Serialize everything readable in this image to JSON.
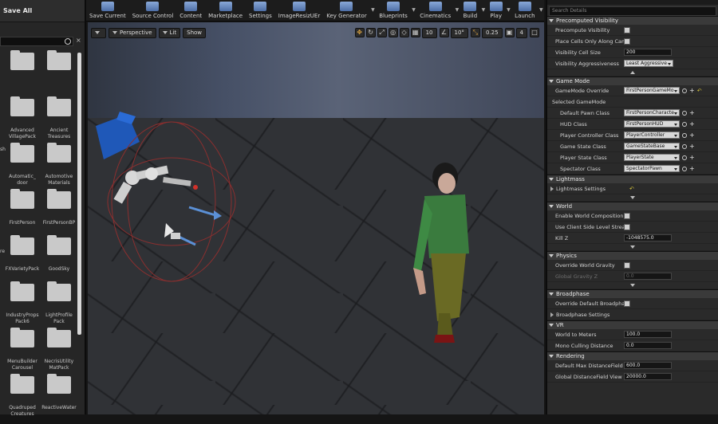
{
  "content_browser": {
    "save_all": "Save All",
    "folders": [
      {
        "label": "",
        "x": 0,
        "y": 0
      },
      {
        "label": "",
        "x": 1,
        "y": 0
      },
      {
        "label": "Advanced VillagePack",
        "x": 0,
        "y": 1
      },
      {
        "label": "Ancient Treasures",
        "x": 1,
        "y": 1
      },
      {
        "label": "Automatic_ door",
        "x": 0,
        "y": 2
      },
      {
        "label": "Automotive Materials",
        "x": 1,
        "y": 2
      },
      {
        "label": "FirstPerson",
        "x": 0,
        "y": 3
      },
      {
        "label": "FirstPersonBP",
        "x": 1,
        "y": 3
      },
      {
        "label": "FXVarietyPack",
        "x": 0,
        "y": 4
      },
      {
        "label": "GoodSky",
        "x": 1,
        "y": 4
      },
      {
        "label": "IndustryProps Pack6",
        "x": 0,
        "y": 5
      },
      {
        "label": "LightProfile Pack",
        "x": 1,
        "y": 5
      },
      {
        "label": "MenuBuilder Carousel",
        "x": 0,
        "y": 6
      },
      {
        "label": "NecrisUtility MatPack",
        "x": 1,
        "y": 6
      },
      {
        "label": "Quadruped Creatures",
        "x": 0,
        "y": 7
      },
      {
        "label": "ReactiveWater",
        "x": 1,
        "y": 7
      }
    ],
    "edge_labels": [
      "sh",
      "re"
    ]
  },
  "toolbar": {
    "buttons": [
      {
        "label": "Save Current",
        "icon": "save-icon"
      },
      {
        "label": "Source Control",
        "icon": "source-control-icon"
      },
      {
        "label": "Content",
        "icon": "content-icon"
      },
      {
        "label": "Marketplace",
        "icon": "marketplace-icon"
      },
      {
        "label": "Settings",
        "icon": "settings-icon"
      },
      {
        "label": "ImageResizUEr",
        "icon": "image-resize-icon"
      },
      {
        "label": "Key Generator",
        "icon": "key-generator-icon"
      },
      {
        "label": "Blueprints",
        "icon": "blueprints-icon"
      },
      {
        "label": "Cinematics",
        "icon": "cinematics-icon"
      },
      {
        "label": "Build",
        "icon": "build-icon"
      },
      {
        "label": "Play",
        "icon": "play-icon"
      },
      {
        "label": "Launch",
        "icon": "launch-icon"
      }
    ]
  },
  "viewport": {
    "view_mode": "Perspective",
    "lit_mode": "Lit",
    "show_label": "Show",
    "grid_snap": "10",
    "rotation_snap": "10°",
    "scale_snap": "0.25",
    "camera_speed": "4"
  },
  "details": {
    "search_placeholder": "Search Details",
    "sections": {
      "precomputed_visibility": "Precomputed Visibility",
      "game_mode": "Game Mode",
      "lightmass": "Lightmass",
      "world": "World",
      "physics": "Physics",
      "broadphase": "Broadphase",
      "vr": "VR",
      "rendering": "Rendering"
    },
    "precompute_visibility": "Precompute Visibility",
    "place_cells": "Place Cells Only Along Camera",
    "visibility_cell_size_label": "Visibility Cell Size",
    "visibility_cell_size": "200",
    "visibility_aggressiveness_label": "Visibility Aggressiveness",
    "visibility_aggressiveness": "Least Aggressive",
    "game_mode_override_label": "GameMode Override",
    "game_mode_override": "FirstPersonGameMo",
    "selected_game_mode": "Selected GameMode",
    "default_pawn_label": "Default Pawn Class",
    "default_pawn": "FirstPersonCharacte",
    "hud_label": "HUD Class",
    "hud": "FirstPersonHUD",
    "player_controller_label": "Player Controller Class",
    "player_controller": "PlayerController",
    "game_state_label": "Game State Class",
    "game_state": "GameStateBase",
    "player_state_label": "Player State Class",
    "player_state": "PlayerState",
    "spectator_label": "Spectator Class",
    "spectator": "SpectatorPawn",
    "lightmass_settings": "Lightmass Settings",
    "enable_world_composition": "Enable World Composition",
    "use_client_side_level_streaming": "Use Client Side Level Streami",
    "kill_z_label": "Kill Z",
    "kill_z": "-1048575.0",
    "override_world_gravity": "Override World Gravity",
    "global_gravity_z_label": "Global Gravity Z",
    "global_gravity_z": "0.0",
    "override_default_broadphase": "Override Default Broadphase",
    "broadphase_settings": "Broadphase Settings",
    "world_to_meters_label": "World to Meters",
    "world_to_meters": "100.0",
    "mono_culling_distance_label": "Mono Culling Distance",
    "mono_culling_distance": "0.0",
    "default_max_distance_field_label": "Default Max DistanceField Oc",
    "default_max_distance_field": "600.0",
    "global_distance_field_label": "Global DistanceField View Dis",
    "global_distance_field": "20000.0"
  },
  "colors": {
    "accent": "#d9a241",
    "panel": "#2a2a2a",
    "section": "#3a3a3a"
  }
}
